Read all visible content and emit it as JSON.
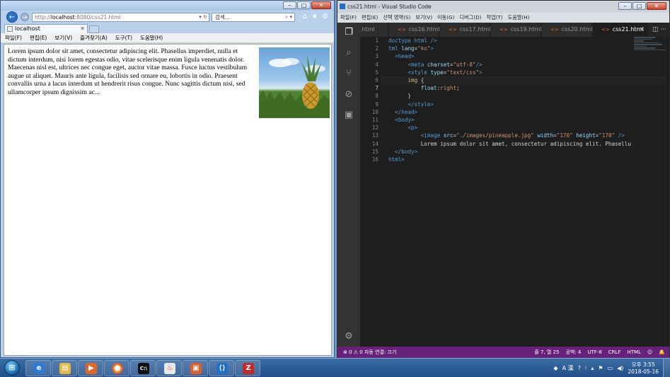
{
  "ie": {
    "address_prefix": "http://",
    "address_host": "localhost",
    "address_rest": ":8080/css21.html",
    "address_controls": "▾ ↻",
    "search_placeholder": "검색...",
    "search_controls": "⌕ ▾",
    "tab_title": "localhost",
    "menu": [
      "파일(F)",
      "편집(E)",
      "보기(V)",
      "즐겨찾기(A)",
      "도구(T)",
      "도움말(H)"
    ],
    "paragraph": "Lorem ipsum dolor sit amet, consectetur adipiscing elit. Phasellus imperdiet, nulla et dictum interdum, nisi lorem egestas odio, vitae scelerisque enim ligula venenatis dolor. Maecenas nisl est, ultrices nec congue eget, auctor vitae massa. Fusce luctus vestibulum augue ut aliquet. Mauris ante ligula, facilisis sed ornare eu, lobortis in odio. Praesent convallis urna a lacus interdum ut hendrerit risus congue. Nunc sagittis dictum nisi, sed ullamcorper ipsum dignissim ac..."
  },
  "vscode": {
    "window_title": "css21.html - Visual Studio Code",
    "menu": [
      "파일(F)",
      "편집(E)",
      "선택 영역(S)",
      "보기(V)",
      "이동(G)",
      "디버그(D)",
      "작업(T)",
      "도움말(H)"
    ],
    "tabs": [
      ".html",
      "css16.html",
      "css17.html",
      "css19.html",
      "css20.html",
      "css21.html"
    ],
    "active_tab": "css21.html",
    "line_numbers": [
      "1",
      "2",
      "3",
      "4",
      "5",
      "6",
      "7",
      "8",
      "9",
      "10",
      "11",
      "12",
      "13",
      "14",
      "15",
      "16"
    ],
    "status_left": "⊗ 0 ⚠ 0   자동 연결: 끄기",
    "status_right": [
      "줄 7, 열 25",
      "공백: 4",
      "UTF-8",
      "CRLF",
      "HTML",
      "☺",
      "🔔"
    ]
  },
  "taskbar": {
    "apps": [
      "ie-icon",
      "explorer-icon",
      "media-player-icon",
      "chrome-icon",
      "cmd-icon",
      "java-icon",
      "editor-icon",
      "vscode-icon",
      "filezilla-icon"
    ],
    "tray_text": "A 漢",
    "time": "오후 3:55",
    "date": "2018-05-16"
  },
  "colors": {
    "vscode_status": "#68217a",
    "vscode_bg": "#1e1e1e",
    "taskbar": "#2a5b95"
  }
}
